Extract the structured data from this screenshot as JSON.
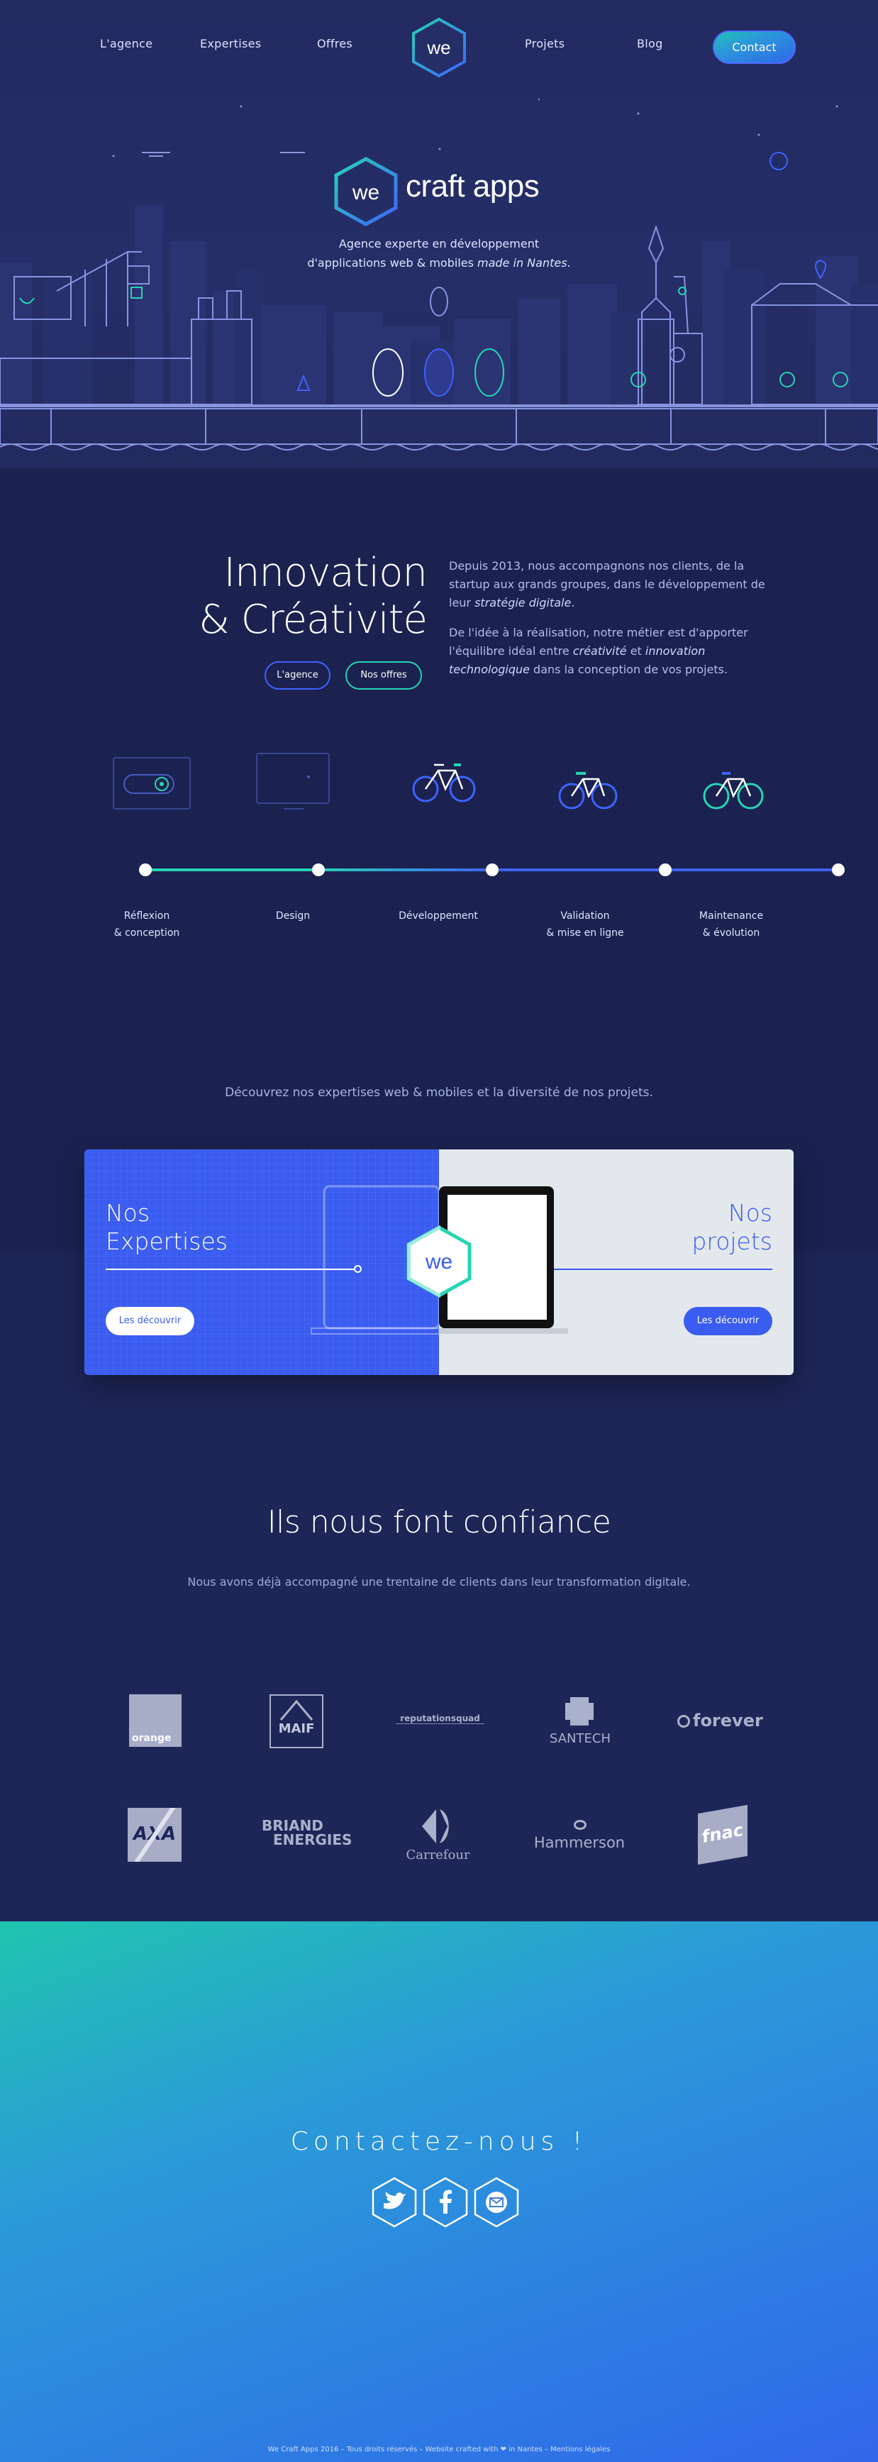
{
  "nav": {
    "items": [
      "L'agence",
      "Expertises",
      "Offres",
      "Projets",
      "Blog"
    ],
    "contact": "Contact",
    "logo_mark": "we"
  },
  "hero": {
    "brand_mark": "we",
    "brand_name": "craft apps",
    "tagline_line1": "Agence experte en développement",
    "tagline_line2_start": "d'applications web & mobiles ",
    "tagline_line2_em": "made in Nantes",
    "tagline_line2_end": "."
  },
  "intro": {
    "title_line1": "Innovation",
    "title_line2": "& Créativité",
    "btn_agency": "L'agence",
    "btn_offers": "Nos offres",
    "p1_start": "Depuis 2013, nous accompagnons nos clients, de la startup aux grands groupes, dans le développement de leur ",
    "p1_em": "stratégie digitale",
    "p1_end": ".",
    "p2_start": "De l'idée à la réalisation, notre métier est d'apporter l'équilibre idéal entre ",
    "p2_em1": "créativité",
    "p2_mid": " et ",
    "p2_em2": "innovation technologique",
    "p2_end": " dans la conception de vos projets."
  },
  "process": {
    "steps": [
      {
        "line1": "Réflexion",
        "line2": "& conception"
      },
      {
        "line1": "Design",
        "line2": ""
      },
      {
        "line1": "Développement",
        "line2": ""
      },
      {
        "line1": "Validation",
        "line2": "& mise en ligne"
      },
      {
        "line1": "Maintenance",
        "line2": "& évolution"
      }
    ],
    "colors": {
      "green": "#27d4b4",
      "blue": "#3f62ff"
    }
  },
  "discover": {
    "lead": "Découvrez nos expertises web & mobiles et la diversité de nos projets.",
    "left_title_1": "Nos",
    "left_title_2": "Expertises",
    "left_button": "Les découvrir",
    "right_title_1": "Nos",
    "right_title_2": "projets",
    "right_button": "Les découvrir",
    "center_mark": "we"
  },
  "clients": {
    "title": "Ils nous font confiance",
    "subtitle": "Nous avons déjà accompagné une trentaine de clients dans leur transformation digitale.",
    "logos": {
      "orange": "orange",
      "maif": "MAIF",
      "reputationsquad": "reputationsquad",
      "santech": "SANTECH",
      "forever": "forever",
      "axa": "AXA",
      "briand_1": "BRIAND",
      "briand_2": "ENERGIES",
      "carrefour": "Carrefour",
      "hammerson": "Hammerson",
      "fnac": "fnac"
    }
  },
  "contact": {
    "title": "Contactez-nous !",
    "icons": [
      "twitter-icon",
      "facebook-icon",
      "mail-icon"
    ]
  },
  "footer": {
    "text": "We Craft Apps 2016 – Tous droits réservés – Website crafted with ❤ in Nantes – Mentions légales"
  },
  "colors": {
    "accent_blue": "#3f62ff",
    "accent_green": "#27d4b4",
    "navy": "#1b2250"
  }
}
